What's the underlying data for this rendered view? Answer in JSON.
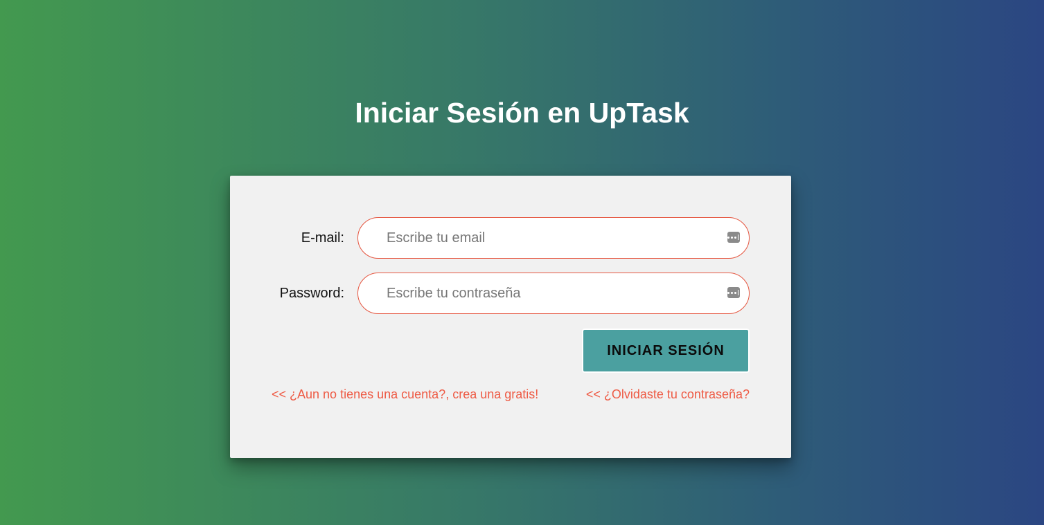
{
  "page": {
    "title": "Iniciar Sesión en UpTask"
  },
  "form": {
    "email": {
      "label": "E-mail:",
      "placeholder": "Escribe tu email",
      "value": ""
    },
    "password": {
      "label": "Password:",
      "placeholder": "Escribe tu contraseña",
      "value": ""
    },
    "submit_label": "Iniciar Sesión"
  },
  "links": {
    "create_account": "<< ¿Aun no tienes una cuenta?, crea una gratis!",
    "forgot_password": "<< ¿Olvidaste tu contraseña?"
  },
  "icons": {
    "field_autofill": "password-manager-key-icon"
  },
  "colors": {
    "background_gradient_start": "#43994f",
    "background_gradient_end": "#2b4682",
    "card_background": "#f1f1f1",
    "input_border": "#e5553f",
    "button_background": "#4ba0a0",
    "link_color": "#ee5a44"
  }
}
